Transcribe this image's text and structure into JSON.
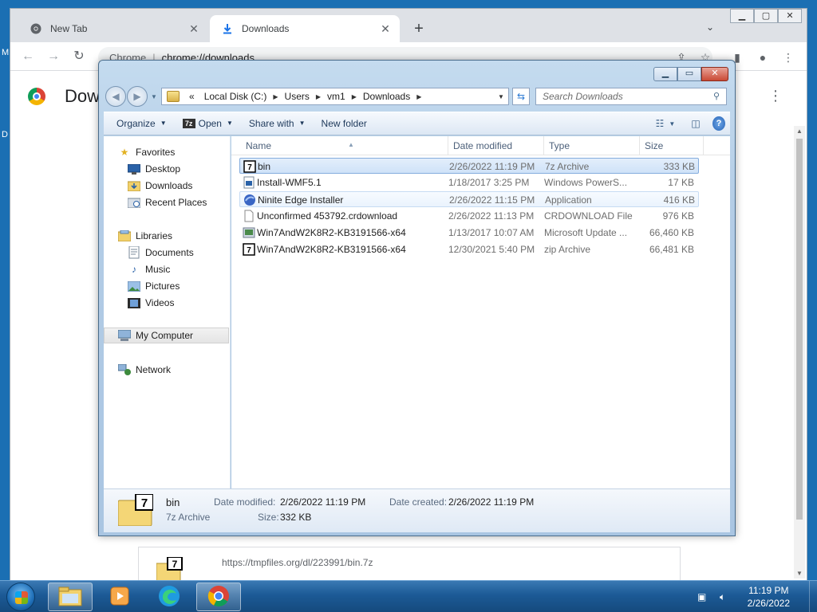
{
  "chrome": {
    "tabs": [
      {
        "label": "New Tab",
        "icon": "chrome-icon"
      },
      {
        "label": "Downloads",
        "icon": "download-icon"
      }
    ],
    "omnibox": {
      "site": "Chrome",
      "url": "chrome://downloads"
    },
    "page_title": "Downloads",
    "download_item": {
      "url": "https://tmpfiles.org/dl/223991/bin.7z"
    },
    "desktop_fragments": [
      "M",
      "D"
    ]
  },
  "explorer": {
    "address": {
      "overflow": "«",
      "crumbs": [
        "Local Disk (C:)",
        "Users",
        "vm1",
        "Downloads"
      ]
    },
    "search_placeholder": "Search Downloads",
    "commands": {
      "organize": "Organize",
      "open": "Open",
      "open_icon_text": "7z",
      "share_with": "Share with",
      "new_folder": "New folder"
    },
    "nav": {
      "favorites": "Favorites",
      "desktop": "Desktop",
      "downloads": "Downloads",
      "recent_places": "Recent Places",
      "libraries": "Libraries",
      "documents": "Documents",
      "music": "Music",
      "pictures": "Pictures",
      "videos": "Videos",
      "my_computer": "My Computer",
      "network": "Network"
    },
    "columns": {
      "name": "Name",
      "date": "Date modified",
      "type": "Type",
      "size": "Size"
    },
    "files": [
      {
        "name": "bin",
        "date": "2/26/2022 11:19 PM",
        "type": "7z Archive",
        "size": "333 KB",
        "icon": "7z-icon"
      },
      {
        "name": "Install-WMF5.1",
        "date": "1/18/2017 3:25 PM",
        "type": "Windows PowerS...",
        "size": "17 KB",
        "icon": "powershell-script-icon"
      },
      {
        "name": "Ninite Edge Installer",
        "date": "2/26/2022 11:15 PM",
        "type": "Application",
        "size": "416 KB",
        "icon": "ninite-icon"
      },
      {
        "name": "Unconfirmed 453792.crdownload",
        "date": "2/26/2022 11:13 PM",
        "type": "CRDOWNLOAD File",
        "size": "976 KB",
        "icon": "blank-file-icon"
      },
      {
        "name": "Win7AndW2K8R2-KB3191566-x64",
        "date": "1/13/2017 10:07 AM",
        "type": "Microsoft Update ...",
        "size": "66,460 KB",
        "icon": "msu-icon"
      },
      {
        "name": "Win7AndW2K8R2-KB3191566-x64",
        "date": "12/30/2021 5:40 PM",
        "type": "zip Archive",
        "size": "66,481 KB",
        "icon": "7z-icon"
      }
    ],
    "details": {
      "name": "bin",
      "type": "7z Archive",
      "date_modified_label": "Date modified:",
      "date_modified": "2/26/2022 11:19 PM",
      "date_created_label": "Date created:",
      "date_created": "2/26/2022 11:19 PM",
      "size_label": "Size:",
      "size": "332 KB"
    }
  },
  "taskbar": {
    "clock_time": "11:19 PM",
    "clock_date": "2/26/2022"
  }
}
